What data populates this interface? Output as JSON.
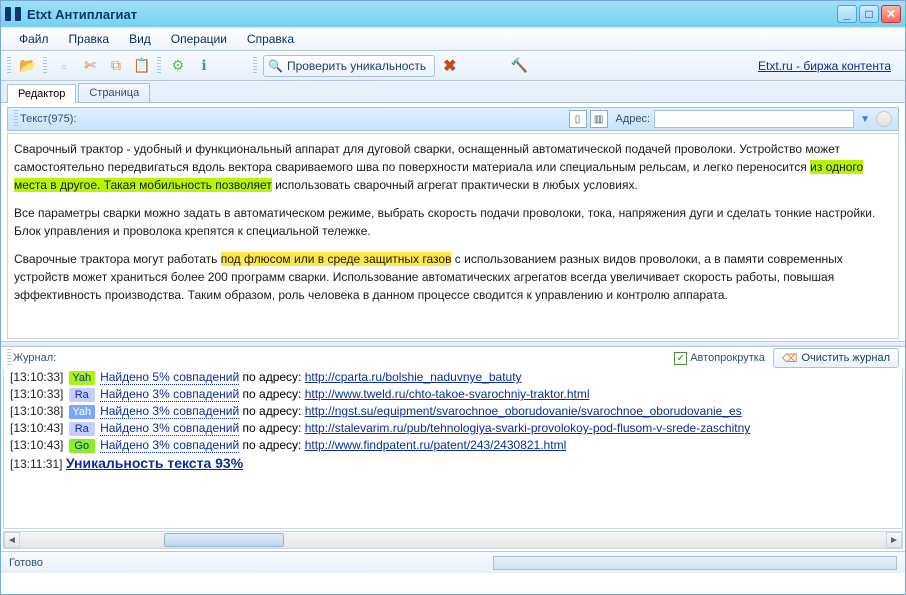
{
  "window": {
    "title": "Etxt Антиплагиат"
  },
  "menu": {
    "file": "Файл",
    "edit": "Правка",
    "view": "Вид",
    "ops": "Операции",
    "help": "Справка"
  },
  "toolbar": {
    "check_label": "Проверить уникальность",
    "extlink": "Etxt.ru - биржа контента"
  },
  "tabs": {
    "editor": "Редактор",
    "page": "Страница"
  },
  "texthead": {
    "label": "Текст(975):",
    "addr_label": "Адрес:",
    "addr_value": ""
  },
  "text": {
    "p1a": "Сварочный трактор - удобный и функциональный аппарат для дуговой сварки, оснащенный автоматической подачей проволоки. Устройство может самостоятельно передвигаться вдоль вектора свариваемого шва по поверхности материала или специальным рельсам, и легко переносится ",
    "p1h": "из одного места в другое. Такая мобильность позволяет",
    "p1b": " использовать сварочный агрегат практически в любых условиях.",
    "p2": "Все параметры сварки можно задать в автоматическом режиме, выбрать скорость подачи проволоки, тока, напряжения дуги и сделать тонкие настройки. Блок управления и проволока крепятся к специальной тележке.",
    "p3a": "Сварочные трактора могут работать ",
    "p3h": "под флюсом или в среде защитных газов",
    "p3b": " с использованием разных видов проволоки, а в памяти современных устройств может храниться более 200 программ сварки. Использование автоматических агрегатов всегда увеличивает скорость работы, повышая эффективность производства. Таким образом, роль человека в данном процессе сводится к управлению и контролю аппарата."
  },
  "log": {
    "label": "Журнал:",
    "auto": "Автопрокрутка",
    "clear": "Очистить журнал",
    "by_addr": " по адресу: ",
    "rows": [
      {
        "ts": "[13:10:33]",
        "eng": "Yah",
        "ec": "yah",
        "match": "Найдено 5% совпадений",
        "url": "http://cparta.ru/bolshie_naduvnye_batuty"
      },
      {
        "ts": "[13:10:33]",
        "eng": "Ra",
        "ec": "ra",
        "match": "Найдено 3% совпадений",
        "url": "http://www.tweld.ru/chto-takoe-svarochniy-traktor.html"
      },
      {
        "ts": "[13:10:38]",
        "eng": "Yah",
        "ec": "yahb",
        "match": "Найдено 3% совпадений",
        "url": "http://ngst.su/equipment/svarochnoe_oborudovanie/svarochnoe_oborudovanie_es"
      },
      {
        "ts": "[13:10:43]",
        "eng": "Ra",
        "ec": "ra",
        "match": "Найдено 3% совпадений",
        "url": "http://stalevarim.ru/pub/tehnologiya-svarki-provolokoy-pod-flusom-v-srede-zaschitny"
      },
      {
        "ts": "[13:10:43]",
        "eng": "Go",
        "ec": "go",
        "match": "Найдено 3% совпадений",
        "url": "http://www.findpatent.ru/patent/243/2430821.html"
      }
    ],
    "final_ts": "[13:11:31]",
    "final": "Уникальность текста 93%"
  },
  "status": {
    "text": "Готово"
  }
}
